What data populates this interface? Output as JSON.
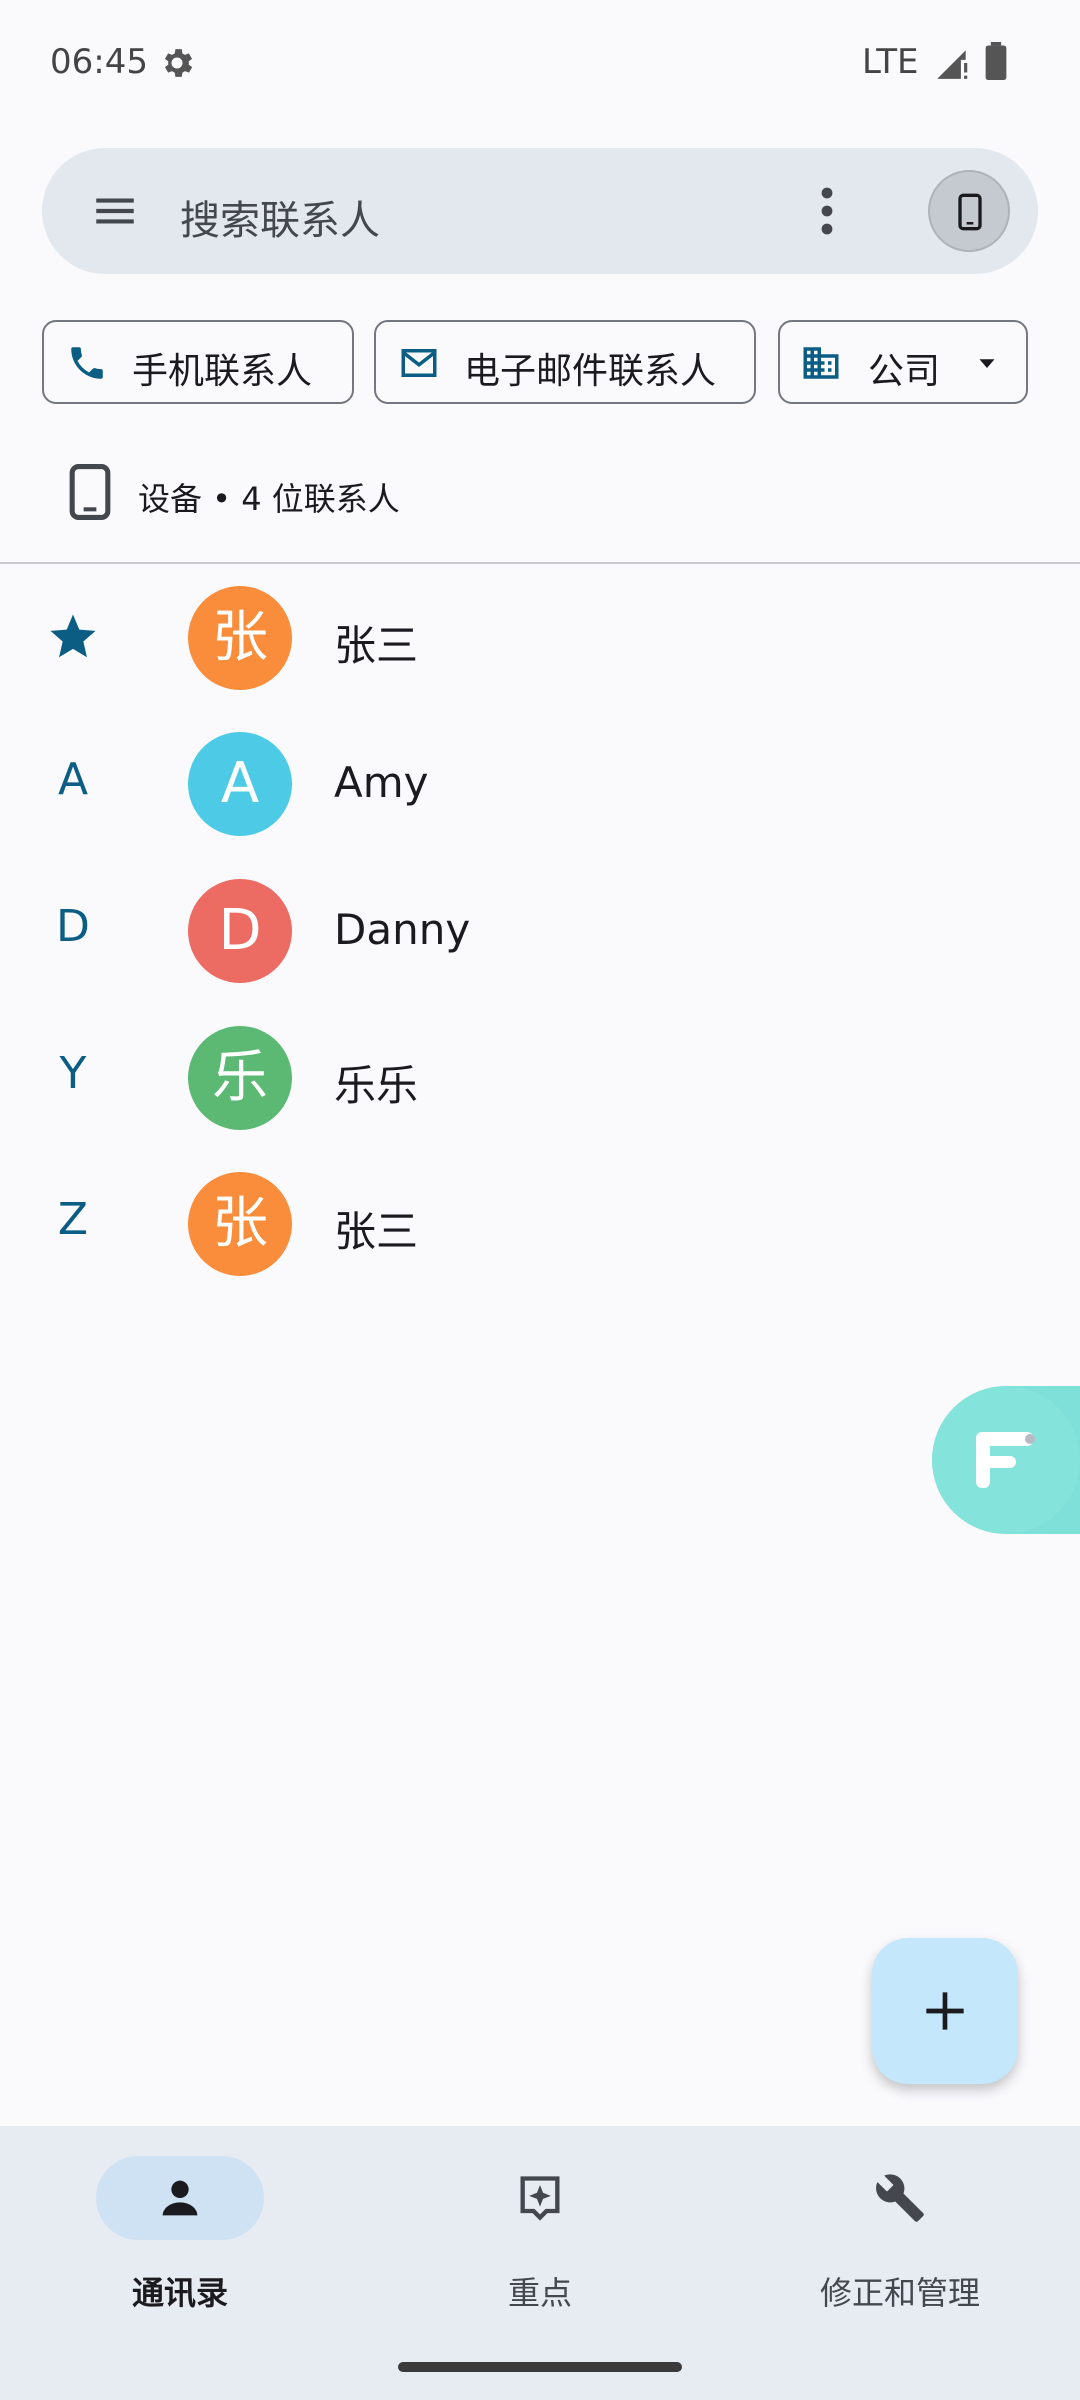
{
  "status_bar": {
    "time": "06:45",
    "network": "LTE"
  },
  "search": {
    "placeholder": "搜索联系人"
  },
  "chips": [
    {
      "label": "手机联系人",
      "icon": "phone-icon"
    },
    {
      "label": "电子邮件联系人",
      "icon": "mail-icon"
    },
    {
      "label": "公司",
      "icon": "building-icon"
    }
  ],
  "account": {
    "text": "设备 • 4 位联系人"
  },
  "contacts": [
    {
      "section": "",
      "starred": true,
      "initial": "张",
      "name": "张三",
      "color": "#f98d3b"
    },
    {
      "section": "A",
      "initial": "A",
      "name": "Amy",
      "color": "#4dcbe6"
    },
    {
      "section": "D",
      "initial": "D",
      "name": "Danny",
      "color": "#ec6b62"
    },
    {
      "section": "Y",
      "initial": "乐",
      "name": "乐乐",
      "color": "#5bb974"
    },
    {
      "section": "Z",
      "initial": "张",
      "name": "张三",
      "color": "#f98d3b"
    }
  ],
  "nav": [
    {
      "label": "通讯录",
      "icon": "person-icon",
      "active": true
    },
    {
      "label": "重点",
      "icon": "highlights-icon",
      "active": false
    },
    {
      "label": "修正和管理",
      "icon": "wrench-icon",
      "active": false
    }
  ],
  "colors": {
    "accent": "#0b5d84",
    "search_bg": "#e2e8ee",
    "fab_bg": "#c5e7fb",
    "nav_bg": "#e7ecf3"
  }
}
